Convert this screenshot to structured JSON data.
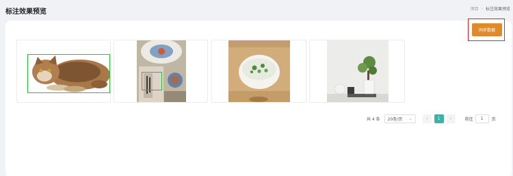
{
  "header": {
    "title": "标注效果预览",
    "breadcrumb": {
      "parent": "项目",
      "current": "标注效果预览"
    }
  },
  "toolbar": {
    "sync_label": "同步数据"
  },
  "images": [
    {
      "subject": "tabby cat lying down",
      "annotated": true
    },
    {
      "subject": "packaged food on patterned plate",
      "annotated": true
    },
    {
      "subject": "bowl of rice with greens",
      "annotated": false
    },
    {
      "subject": "bonsai and tea set",
      "annotated": false
    }
  ],
  "pagination": {
    "total": "共 4 条",
    "page_size": "20条/页",
    "current_page": "1",
    "goto_label": "前往",
    "goto_value": "1",
    "page_unit": "页"
  },
  "colors": {
    "accent": "#e08a2e",
    "highlight": "#e6262e",
    "bbox": "#2dbb3a",
    "active_page": "#3fb1a5"
  }
}
